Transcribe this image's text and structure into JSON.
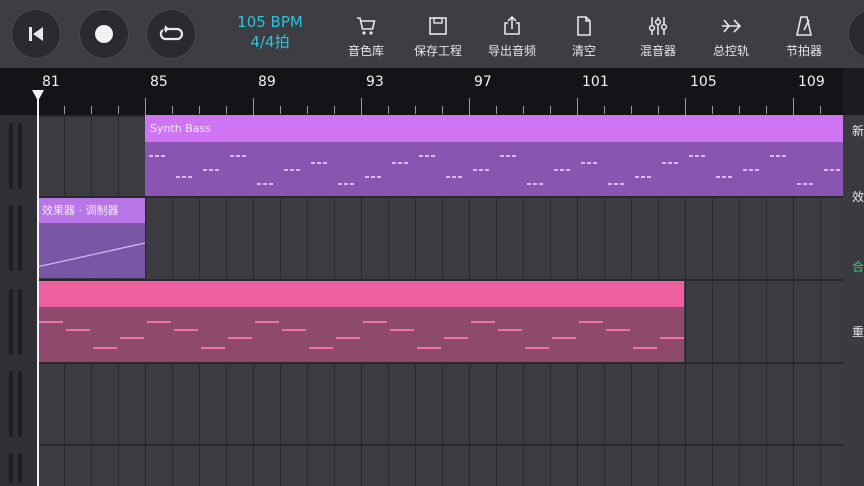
{
  "transport": {
    "rewind_icon": "skip-to-start-icon",
    "record_icon": "record-icon",
    "loop_icon": "loop-icon"
  },
  "tempo": {
    "bpm": "105 BPM",
    "signature": "4/4拍"
  },
  "tools": [
    {
      "label": "音色库",
      "icon": "shopping-cart-icon"
    },
    {
      "label": "保存工程",
      "icon": "save-icon"
    },
    {
      "label": "导出音频",
      "icon": "share-export-icon"
    },
    {
      "label": "清空",
      "icon": "blank-file-icon"
    },
    {
      "label": "混音器",
      "icon": "mixer-sliders-icon"
    },
    {
      "label": "总控轨",
      "icon": "master-track-icon"
    },
    {
      "label": "节拍器",
      "icon": "metronome-icon"
    }
  ],
  "ruler": {
    "bars": [
      "81",
      "85",
      "89",
      "93",
      "97",
      "101",
      "105",
      "109"
    ]
  },
  "clips": {
    "synth_bass": {
      "label": "Synth Bass",
      "color": "#cf74f2",
      "body": "#8a55b1"
    },
    "automation": {
      "label": "效果器 · 调制器",
      "color": "#b876e6",
      "body": "#7a56a7"
    },
    "pink": {
      "label": "",
      "color": "#ee5fa0",
      "body": "#8d4a6d"
    }
  },
  "side_labels": [
    "新",
    "效",
    "合",
    "重"
  ],
  "colors": {
    "accent_tempo": "#2bc4dc",
    "side_green": "#2fd46a"
  }
}
